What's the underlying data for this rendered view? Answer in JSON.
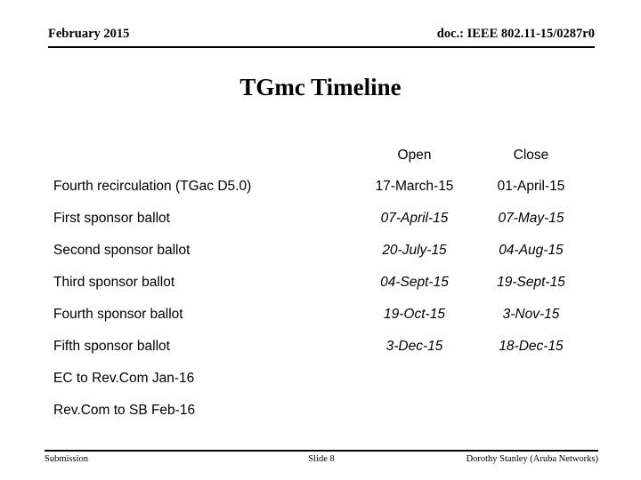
{
  "header": {
    "left": "February 2015",
    "right": "doc.: IEEE 802.11-15/0287r0"
  },
  "title": "TGmc Timeline",
  "table": {
    "columns": {
      "task": "",
      "open": "Open",
      "close": "Close"
    },
    "rows": [
      {
        "task": "Fourth recirculation (TGac D5.0)",
        "open": "17-March-15",
        "close": "01-April-15",
        "italic": false
      },
      {
        "task": "First sponsor ballot",
        "open": "07-April-15",
        "close": "07-May-15",
        "italic": true
      },
      {
        "task": "Second sponsor ballot",
        "open": "20-July-15",
        "close": "04-Aug-15",
        "italic": true
      },
      {
        "task": "Third sponsor ballot",
        "open": "04-Sept-15",
        "close": "19-Sept-15",
        "italic": true
      },
      {
        "task": "Fourth sponsor ballot",
        "open": "19-Oct-15",
        "close": "3-Nov-15",
        "italic": true
      },
      {
        "task": "Fifth sponsor ballot",
        "open": "3-Dec-15",
        "close": "18-Dec-15",
        "italic": true
      },
      {
        "task": "EC to Rev.Com Jan-16",
        "open": "",
        "close": "",
        "italic": false
      },
      {
        "task": "Rev.Com to SB Feb-16",
        "open": "",
        "close": "",
        "italic": false
      }
    ]
  },
  "footer": {
    "left": "Submission",
    "center": "Slide 8",
    "right": "Dorothy Stanley (Aruba Networks)"
  }
}
